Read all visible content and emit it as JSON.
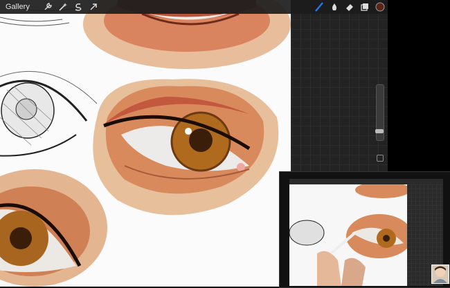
{
  "toolbar": {
    "gallery_label": "Gallery",
    "left_tools": [
      {
        "icon": "wrench-icon"
      },
      {
        "icon": "magic-wand-icon"
      },
      {
        "icon": "selection-icon"
      },
      {
        "icon": "transform-arrow-icon"
      }
    ],
    "right_tools": [
      {
        "icon": "brush-icon",
        "active": true
      },
      {
        "icon": "smudge-icon"
      },
      {
        "icon": "eraser-icon"
      },
      {
        "icon": "layers-icon"
      }
    ],
    "color_swatch": "#5a2418",
    "accent": "#1e7bff"
  },
  "colors": {
    "iris": "#b06a1e",
    "skin": "#d7946a",
    "lid_shadow": "#c8593a"
  }
}
